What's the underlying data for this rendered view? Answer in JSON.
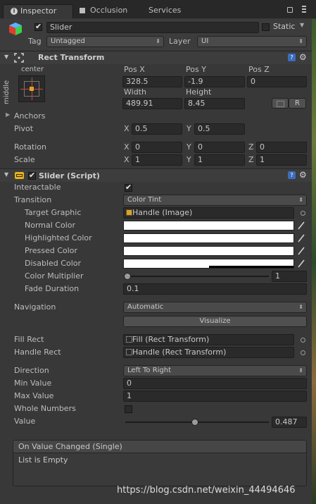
{
  "tabs": [
    {
      "label": "Inspector"
    },
    {
      "label": "Occlusion"
    },
    {
      "label": "Services"
    }
  ],
  "object": {
    "name": "Slider",
    "active": true,
    "static_label": "Static",
    "tag_label": "Tag",
    "tag_value": "Untagged",
    "layer_label": "Layer",
    "layer_value": "UI"
  },
  "rect_transform": {
    "title": "Rect Transform",
    "anchor_h": "center",
    "anchor_v": "middle",
    "pos_x_label": "Pos X",
    "pos_x": "328.5",
    "pos_y_label": "Pos Y",
    "pos_y": "-1.9",
    "pos_z_label": "Pos Z",
    "pos_z": "0",
    "width_label": "Width",
    "width": "489.91",
    "height_label": "Height",
    "height": "8.45",
    "r_button": "R",
    "anchors_label": "Anchors",
    "pivot_label": "Pivot",
    "pivot_x": "0.5",
    "pivot_y": "0.5",
    "rotation_label": "Rotation",
    "rot_x": "0",
    "rot_y": "0",
    "rot_z": "0",
    "scale_label": "Scale",
    "scale_x": "1",
    "scale_y": "1",
    "scale_z": "1",
    "x": "X",
    "y": "Y",
    "z": "Z"
  },
  "slider": {
    "title": "Slider (Script)",
    "enabled": true,
    "interactable_label": "Interactable",
    "interactable": true,
    "transition_label": "Transition",
    "transition_value": "Color Tint",
    "target_graphic_label": "Target Graphic",
    "target_graphic_value": "Handle (Image)",
    "normal_color_label": "Normal Color",
    "normal_color": "#ffffff",
    "highlighted_color_label": "Highlighted Color",
    "highlighted_color": "#f5f5f5",
    "pressed_color_label": "Pressed Color",
    "pressed_color": "#c8c8c8",
    "disabled_color_label": "Disabled Color",
    "disabled_color": "#c8c8c8",
    "color_multiplier_label": "Color Multiplier",
    "color_multiplier": "1",
    "color_multiplier_fraction": 0.0,
    "fade_duration_label": "Fade Duration",
    "fade_duration": "0.1",
    "navigation_label": "Navigation",
    "navigation_value": "Automatic",
    "visualize_button": "Visualize",
    "fill_rect_label": "Fill Rect",
    "fill_rect_value": "Fill (Rect Transform)",
    "handle_rect_label": "Handle Rect",
    "handle_rect_value": "Handle (Rect Transform)",
    "direction_label": "Direction",
    "direction_value": "Left To Right",
    "min_value_label": "Min Value",
    "min_value": "0",
    "max_value_label": "Max Value",
    "max_value": "1",
    "whole_numbers_label": "Whole Numbers",
    "whole_numbers": false,
    "value_label": "Value",
    "value": "0.487",
    "value_fraction": 0.487
  },
  "event": {
    "title": "On Value Changed (Single)",
    "empty_text": "List is Empty"
  },
  "watermark": "https://blog.csdn.net/weixin_44494646",
  "colors": {
    "panel": "#383838",
    "header": "#3d3d3d",
    "field": "#2a2a2a"
  }
}
